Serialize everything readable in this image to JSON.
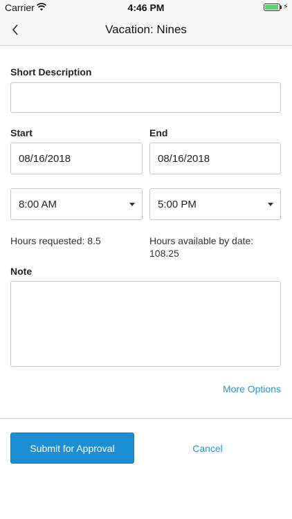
{
  "status_bar": {
    "carrier": "Carrier",
    "time": "4:46 PM",
    "battery_level": 0.95
  },
  "nav": {
    "title": "Vacation: Nines"
  },
  "form": {
    "short_description": {
      "label": "Short Description",
      "value": ""
    },
    "start": {
      "label": "Start",
      "date": "08/16/2018",
      "time": "8:00 AM"
    },
    "end": {
      "label": "End",
      "date": "08/16/2018",
      "time": "5:00 PM"
    },
    "hours_requested": "Hours requested: 8.5",
    "hours_available_label": "Hours available by date:",
    "hours_available_value": "108.25",
    "note": {
      "label": "Note",
      "value": ""
    },
    "more_options": "More Options"
  },
  "actions": {
    "submit": "Submit for Approval",
    "cancel": "Cancel"
  },
  "colors": {
    "accent": "#1b8fd6",
    "link": "#2a94cf",
    "battery": "#4cd964"
  }
}
